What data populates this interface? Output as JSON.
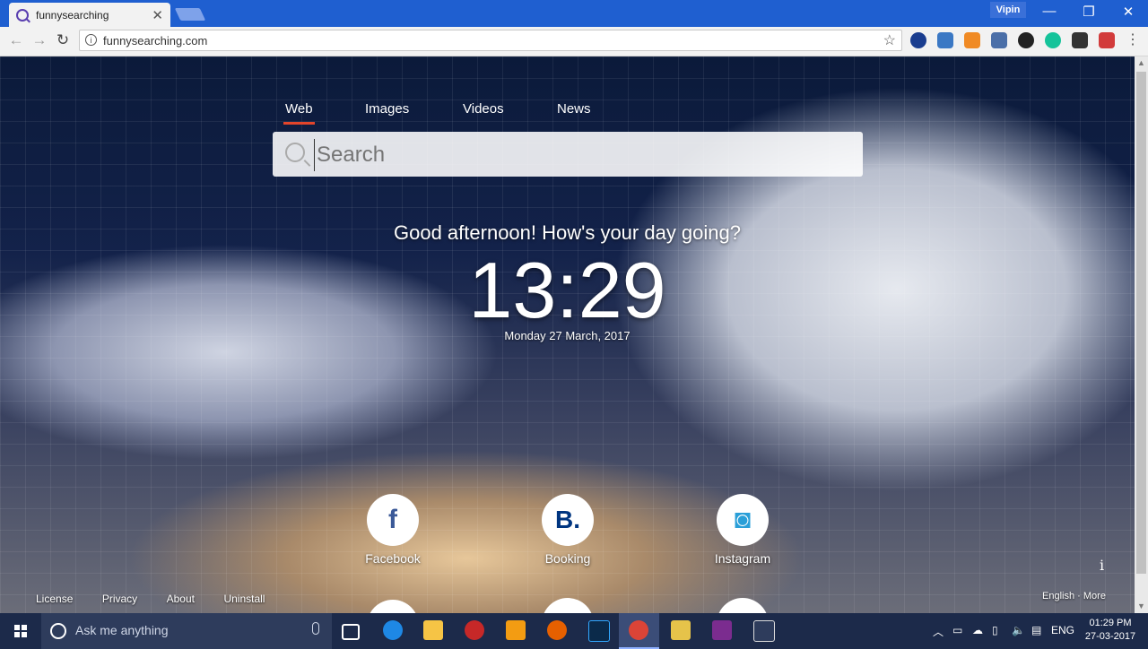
{
  "browser": {
    "tab_title": "funnysearching",
    "tab_close": "✕",
    "profile_name": "Vipin",
    "window_controls": {
      "minimize": "—",
      "maximize": "❐",
      "close": "✕"
    },
    "nav": {
      "back": "←",
      "forward": "→",
      "reload": "↻"
    },
    "address": "funnysearching.com",
    "info": "i",
    "bookmark_star": "☆"
  },
  "page": {
    "search_tabs": [
      {
        "label": "Web",
        "active": true
      },
      {
        "label": "Images",
        "active": false
      },
      {
        "label": "Videos",
        "active": false
      },
      {
        "label": "News",
        "active": false
      }
    ],
    "search_placeholder": "Search",
    "greeting": "Good afternoon! How's your day going?",
    "clock": "13:29",
    "date": "Monday 27 March, 2017",
    "tiles": [
      {
        "label": "Facebook",
        "glyph": "f",
        "color": "#3b5998"
      },
      {
        "label": "Booking",
        "glyph": "B.",
        "color": "#003580"
      },
      {
        "label": "Instagram",
        "glyph": "◙",
        "color": "#2a9fd8"
      }
    ],
    "footer_links": [
      "License",
      "Privacy",
      "About",
      "Uninstall"
    ],
    "footer_right": [
      "English",
      "More"
    ],
    "info_glyph": "i"
  },
  "taskbar": {
    "search_text": "Ask me anything",
    "language": "ENG",
    "time": "01:29 PM",
    "date": "27-03-2017"
  },
  "colors": {
    "titlebar": "#1f5fd0",
    "active_tab_underline": "#e2452b",
    "taskbar": "#1c2a4a"
  }
}
